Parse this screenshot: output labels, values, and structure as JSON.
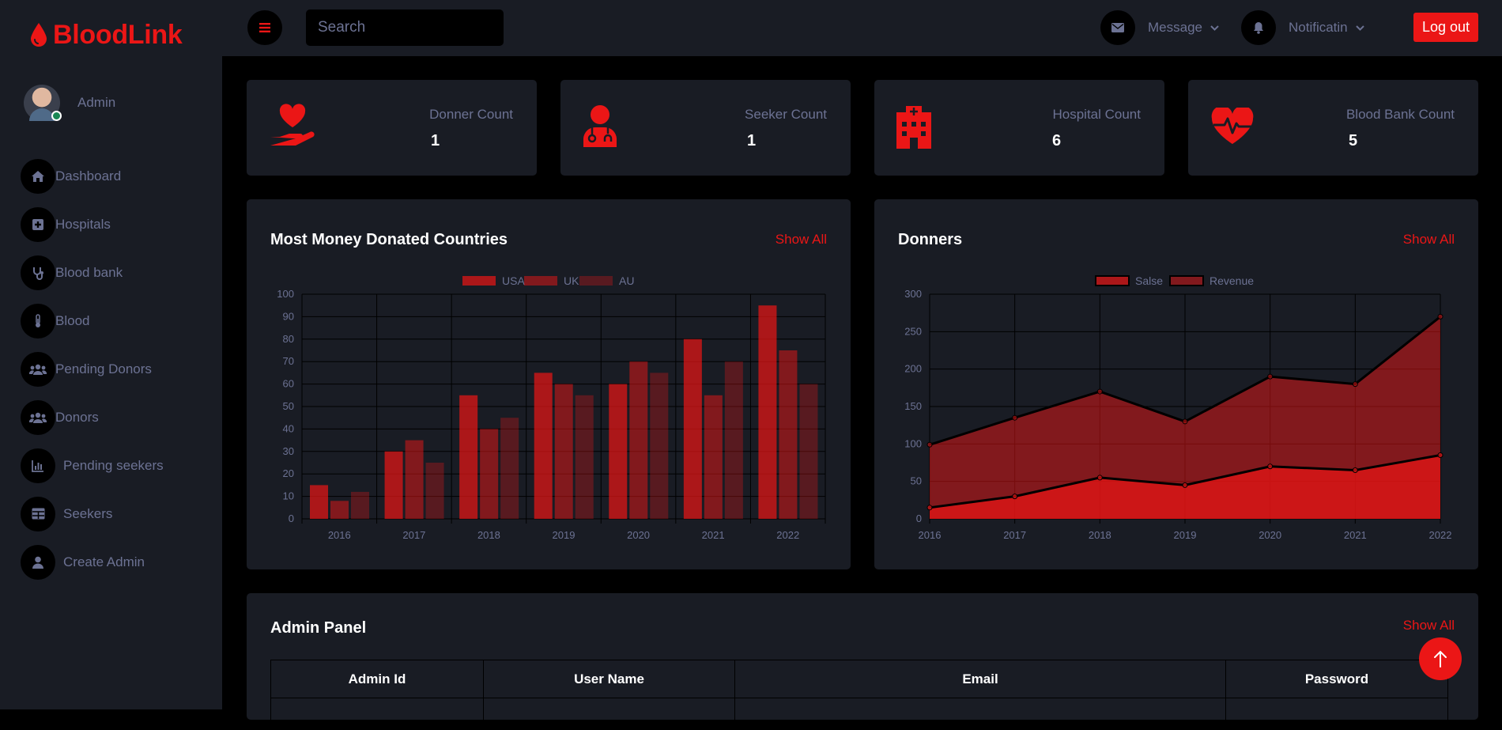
{
  "brand": {
    "name": "BloodLink"
  },
  "profile": {
    "name": "Admin"
  },
  "nav": {
    "items": [
      {
        "label": "Dashboard",
        "icon": "home-icon"
      },
      {
        "label": "Hospitals",
        "icon": "hospital-plus-icon"
      },
      {
        "label": "Blood bank",
        "icon": "stethoscope-icon"
      },
      {
        "label": "Blood",
        "icon": "thermometer-icon"
      },
      {
        "label": "Pending Donors",
        "icon": "users-icon"
      },
      {
        "label": "Donors",
        "icon": "users-icon"
      },
      {
        "label": "Pending seekers",
        "icon": "bar-chart-icon"
      },
      {
        "label": "Seekers",
        "icon": "table-icon"
      },
      {
        "label": "Create Admin",
        "icon": "user-icon"
      }
    ]
  },
  "topbar": {
    "search_placeholder": "Search",
    "message_label": "Message",
    "notification_label": "Notificatin",
    "logout_label": "Log out"
  },
  "stats": [
    {
      "label": "Donner Count",
      "value": "1",
      "icon": "hand-heart-icon"
    },
    {
      "label": "Seeker Count",
      "value": "1",
      "icon": "user-doctor-icon"
    },
    {
      "label": "Hospital Count",
      "value": "6",
      "icon": "hospital-building-icon"
    },
    {
      "label": "Blood Bank Count",
      "value": "5",
      "icon": "heart-pulse-icon"
    }
  ],
  "colors": {
    "accent": "#eb1616",
    "panel": "#191c24",
    "background": "#000000",
    "muted": "#6c7293"
  },
  "countries_panel": {
    "title": "Most Money Donated Countries",
    "show_all": "Show All"
  },
  "donners_panel": {
    "title": "Donners",
    "show_all": "Show All"
  },
  "admin_panel": {
    "title": "Admin Panel",
    "show_all": "Show All",
    "columns": [
      "Admin Id",
      "User Name",
      "Email",
      "Password"
    ]
  },
  "chart_data": [
    {
      "type": "bar",
      "categories": [
        "2016",
        "2017",
        "2018",
        "2019",
        "2020",
        "2021",
        "2022"
      ],
      "series": [
        {
          "name": "USA",
          "values": [
            15,
            30,
            55,
            65,
            60,
            80,
            95
          ],
          "color": "rgba(235,22,22,0.7)"
        },
        {
          "name": "UK",
          "values": [
            8,
            35,
            40,
            60,
            70,
            55,
            75
          ],
          "color": "rgba(235,22,22,0.5)"
        },
        {
          "name": "AU",
          "values": [
            12,
            25,
            45,
            55,
            65,
            70,
            60
          ],
          "color": "rgba(235,22,22,0.3)"
        }
      ],
      "ylim": [
        0,
        100
      ],
      "yticks": [
        0,
        10,
        20,
        30,
        40,
        50,
        60,
        70,
        80,
        90,
        100
      ],
      "grid": true,
      "legend": "top-center"
    },
    {
      "type": "area",
      "categories": [
        "2016",
        "2017",
        "2018",
        "2019",
        "2020",
        "2021",
        "2022"
      ],
      "series": [
        {
          "name": "Salse",
          "values": [
            15,
            30,
            55,
            45,
            70,
            65,
            85
          ],
          "color": "rgba(235,22,22,0.7)"
        },
        {
          "name": "Revenue",
          "values": [
            99,
            135,
            170,
            130,
            190,
            180,
            270
          ],
          "color": "rgba(235,22,22,0.5)"
        }
      ],
      "ylim": [
        0,
        300
      ],
      "yticks": [
        0,
        50,
        100,
        150,
        200,
        250,
        300
      ],
      "grid": true,
      "legend": "top-center"
    }
  ]
}
